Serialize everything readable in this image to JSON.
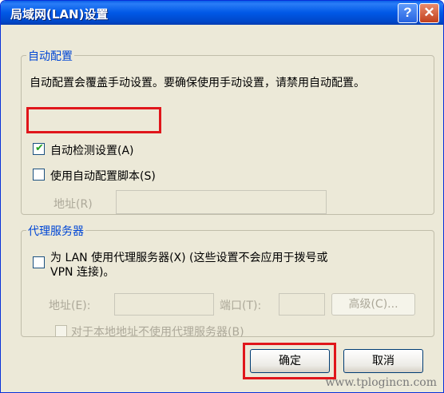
{
  "window": {
    "title": "局域网(LAN)设置",
    "help_glyph": "?",
    "close_glyph": "✕"
  },
  "auto_config": {
    "group_label": "自动配置",
    "description": "自动配置会覆盖手动设置。要确保使用手动设置，请禁用自动配置。",
    "auto_detect": {
      "label": "自动检测设置(A)",
      "checked": true
    },
    "use_script": {
      "label": "使用自动配置脚本(S)",
      "checked": false
    },
    "address_label": "地址(R)",
    "address_value": ""
  },
  "proxy": {
    "group_label": "代理服务器",
    "use_proxy_label_line1": "为 LAN 使用代理服务器(X) (这些设置不会应用于拨号或",
    "use_proxy_label_line2": "VPN 连接)。",
    "address_label": "地址(E):",
    "address_value": "",
    "port_label": "端口(T):",
    "port_value": "",
    "advanced_label": "高级(C)...",
    "bypass_label": "对于本地地址不使用代理服务器(B)"
  },
  "buttons": {
    "ok": "确定",
    "cancel": "取消"
  },
  "watermark": "www.tplogincn.com",
  "colors": {
    "title_bar": "#0058e6",
    "group_label": "#0046d5",
    "highlight": "#e0161b",
    "check": "#21a121"
  }
}
